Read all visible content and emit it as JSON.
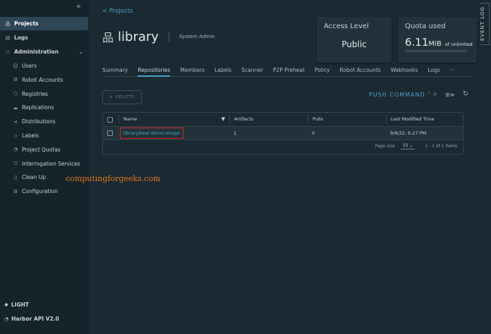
{
  "sidebar": {
    "collapse_icon": "double-chevron-left",
    "items": [
      {
        "label": "Projects",
        "icon": "projects"
      },
      {
        "label": "Logs",
        "icon": "logs"
      },
      {
        "label": "Administration",
        "icon": "administration"
      }
    ],
    "admin_items": [
      {
        "label": "Users"
      },
      {
        "label": "Robot Accounts"
      },
      {
        "label": "Registries"
      },
      {
        "label": "Replications"
      },
      {
        "label": "Distributions"
      },
      {
        "label": "Labels"
      },
      {
        "label": "Project Quotas"
      },
      {
        "label": "Interrogation Services"
      },
      {
        "label": "Clean Up"
      },
      {
        "label": "Configuration"
      }
    ],
    "theme_label": "LIGHT",
    "api_label": "Harbor API V2.0"
  },
  "header": {
    "back": "< Projects",
    "project_name": "library",
    "role": "System Admin"
  },
  "cards": {
    "access_label": "Access Level",
    "access_value": "Public",
    "quota_label": "Quota used",
    "quota_value": "6.11",
    "quota_unit": "MiB",
    "quota_suffix": "of unlimited",
    "quota_fraction": 0
  },
  "event_log": "EVENT LOG",
  "tabs": [
    "Summary",
    "Repositories",
    "Members",
    "Labels",
    "Scanner",
    "P2P Preheat",
    "Policy",
    "Robot Accounts",
    "Webhooks",
    "Logs",
    "···"
  ],
  "toolbar": {
    "delete": "✕ DELETE",
    "push": "PUSH COMMAND ˅"
  },
  "table": {
    "columns": [
      "Name",
      "Artifacts",
      "Pulls",
      "Last Modified Time"
    ],
    "rows": [
      {
        "name": "library/keel-demo-image",
        "artifacts": "1",
        "pulls": "0",
        "modified": "9/8/22, 6:27 PM"
      }
    ],
    "page_size_label": "Page size",
    "page_size": "15",
    "range": "1 - 1 of 1 items"
  },
  "watermark": "computingforgeeks.com",
  "colors": {
    "accent": "#4aa3c6",
    "highlight": "#dd2222"
  }
}
